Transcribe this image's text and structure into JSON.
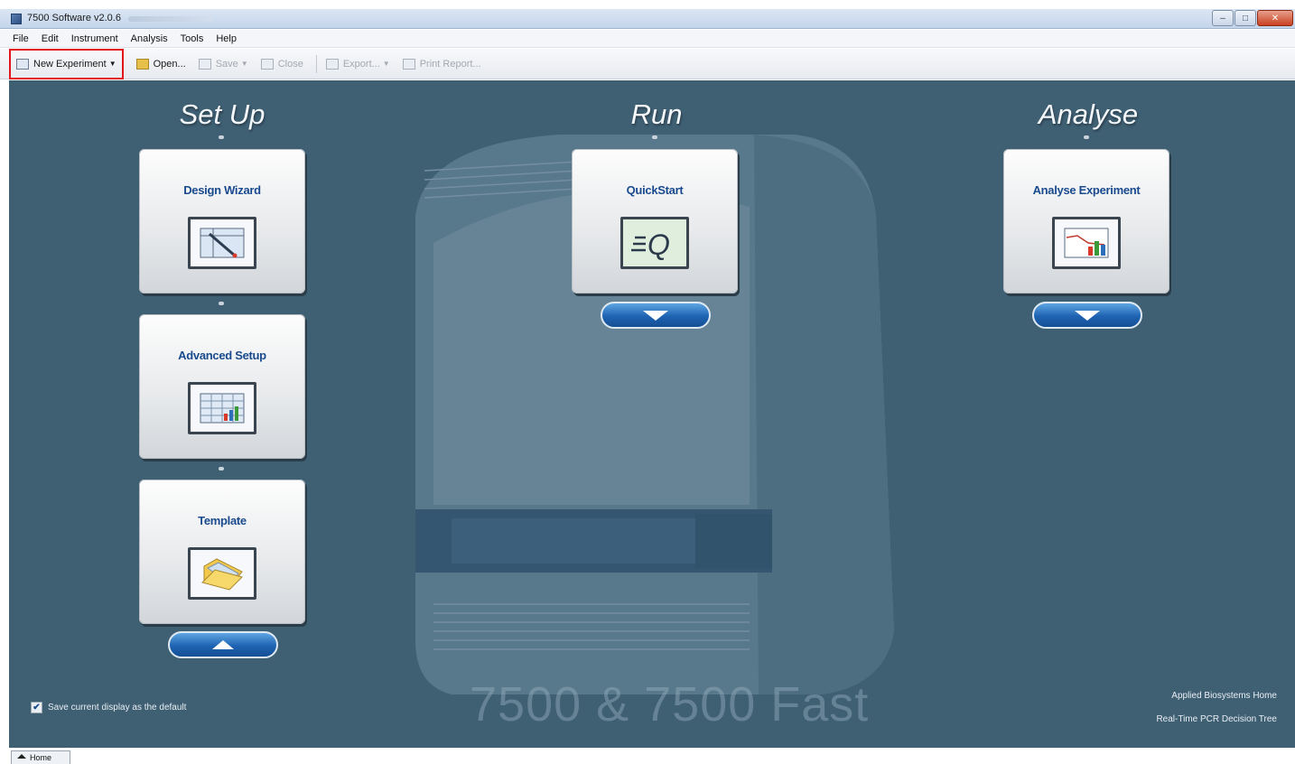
{
  "window": {
    "title": "7500 Software v2.0.6"
  },
  "menu": [
    "File",
    "Edit",
    "Instrument",
    "Analysis",
    "Tools",
    "Help"
  ],
  "toolbar": {
    "new_experiment": "New Experiment",
    "open": "Open...",
    "save": "Save",
    "close": "Close",
    "export": "Export...",
    "print_report": "Print Report..."
  },
  "sections": {
    "setup": {
      "title": "Set Up"
    },
    "run": {
      "title": "Run"
    },
    "analyse": {
      "title": "Analyse"
    }
  },
  "cards": {
    "design_wizard": "Design Wizard",
    "advanced_setup": "Advanced Setup",
    "template": "Template",
    "quickstart": "QuickStart",
    "analyse_experiment": "Analyse Experiment"
  },
  "instrument": {
    "name": "7500 & 7500 Fast"
  },
  "footer": {
    "save_default": "Save current display as the default",
    "save_default_checked": true,
    "link_home": "Applied Biosystems Home",
    "link_decision_tree": "Real-Time PCR Decision Tree"
  },
  "tabs": {
    "home": "Home"
  },
  "colors": {
    "background": "#3f5f73",
    "card_label": "#1a4a8e",
    "highlight": "#e3141b",
    "pill": "#1e63b2"
  }
}
